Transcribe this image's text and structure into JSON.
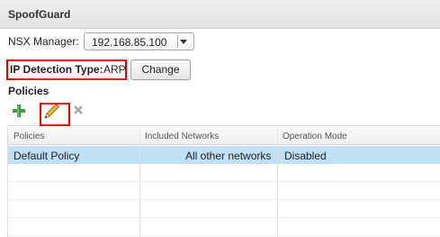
{
  "window": {
    "title": "SpoofGuard"
  },
  "nsx_manager": {
    "label": "NSX Manager:",
    "selected": "192.168.85.100"
  },
  "ip_detection": {
    "label": "IP Detection Type:",
    "value": "ARP",
    "change_label": "Change"
  },
  "policies": {
    "heading": "Policies",
    "toolbar": {
      "add_icon": "plus-icon",
      "edit_icon": "pencil-icon",
      "delete_icon": "x-icon",
      "accent": "#e00000"
    },
    "columns": [
      "Policies",
      "Included Networks",
      "Operation Mode"
    ],
    "rows": [
      {
        "policy": "Default Policy",
        "networks": "All other networks",
        "mode": "Disabled",
        "selected": true
      }
    ]
  }
}
